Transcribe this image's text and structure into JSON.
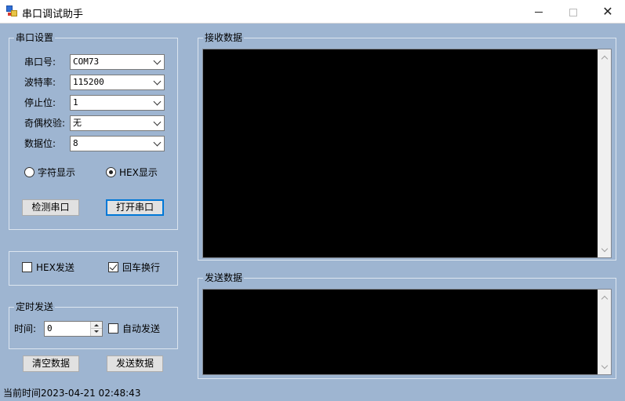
{
  "window": {
    "title": "串口调试助手",
    "controls": {
      "minimize": "minimize-icon",
      "maximize": "maximize-icon",
      "close": "close-icon"
    }
  },
  "serial_settings": {
    "group_title": "串口设置",
    "fields": [
      {
        "label": "串口号:",
        "value": "COM73"
      },
      {
        "label": "波特率:",
        "value": "115200"
      },
      {
        "label": "停止位:",
        "value": "1"
      },
      {
        "label": "奇偶校验:",
        "value": "无"
      },
      {
        "label": "数据位:",
        "value": "8"
      }
    ],
    "display_mode": {
      "options": [
        "字符显示",
        "HEX显示"
      ],
      "selected": "HEX显示"
    },
    "detect_button": "检测串口",
    "open_button": "打开串口"
  },
  "send_options": {
    "hex_send": {
      "label": "HEX发送",
      "checked": false
    },
    "newline": {
      "label": "回车换行",
      "checked": true
    }
  },
  "timed_send": {
    "group_title": "定时发送",
    "time_label": "时间:",
    "time_value": "0",
    "auto_send": {
      "label": "自动发送",
      "checked": false
    }
  },
  "buttons": {
    "clear": "清空数据",
    "send": "发送数据"
  },
  "receive": {
    "group_title": "接收数据",
    "content": ""
  },
  "send": {
    "group_title": "发送数据",
    "content": ""
  },
  "status": {
    "text": "当前时间2023-04-21 02:48:43"
  },
  "colors": {
    "background": "#9eb5d1",
    "textarea": "#000000",
    "focus": "#0078d7"
  }
}
